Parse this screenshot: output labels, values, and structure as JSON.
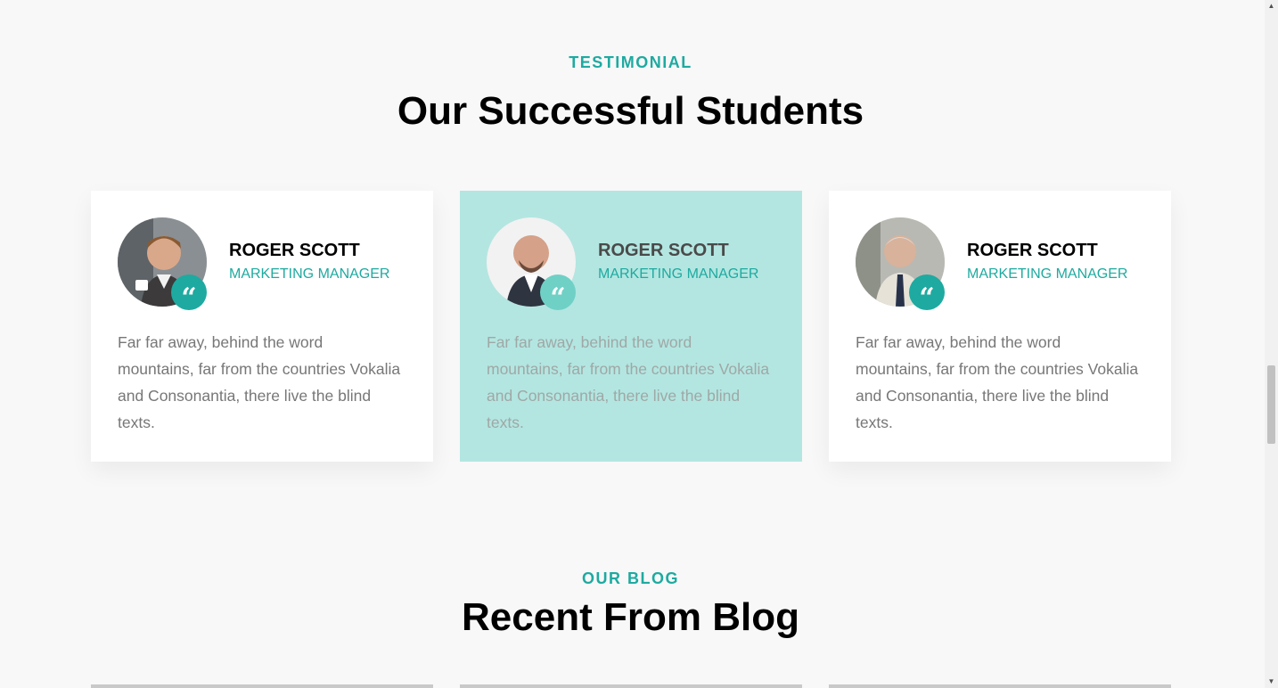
{
  "testimonial": {
    "eyebrow": "TESTIMONIAL",
    "heading": "Our Successful Students",
    "cards": [
      {
        "name": "ROGER SCOTT",
        "role": "MARKETING MANAGER",
        "text": "Far far away, behind the word mountains, far from the countries Vokalia and Consonantia, there live the blind texts.",
        "quote_glyph": "“",
        "active": false
      },
      {
        "name": "ROGER SCOTT",
        "role": "MARKETING MANAGER",
        "text": "Far far away, behind the word mountains, far from the countries Vokalia and Consonantia, there live the blind texts.",
        "quote_glyph": "“",
        "active": true
      },
      {
        "name": "ROGER SCOTT",
        "role": "MARKETING MANAGER",
        "text": "Far far away, behind the word mountains, far from the countries Vokalia and Consonantia, there live the blind texts.",
        "quote_glyph": "“",
        "active": false
      }
    ]
  },
  "blog": {
    "eyebrow": "OUR BLOG",
    "heading": "Recent From Blog"
  },
  "icons": {
    "quote": "quote-icon",
    "avatar": "avatar-photo",
    "scroll_up": "▲",
    "scroll_down": "▼"
  },
  "colors": {
    "accent": "#1eaaa0",
    "active_card": "#b3e6e1",
    "background": "#f8f8f8"
  }
}
